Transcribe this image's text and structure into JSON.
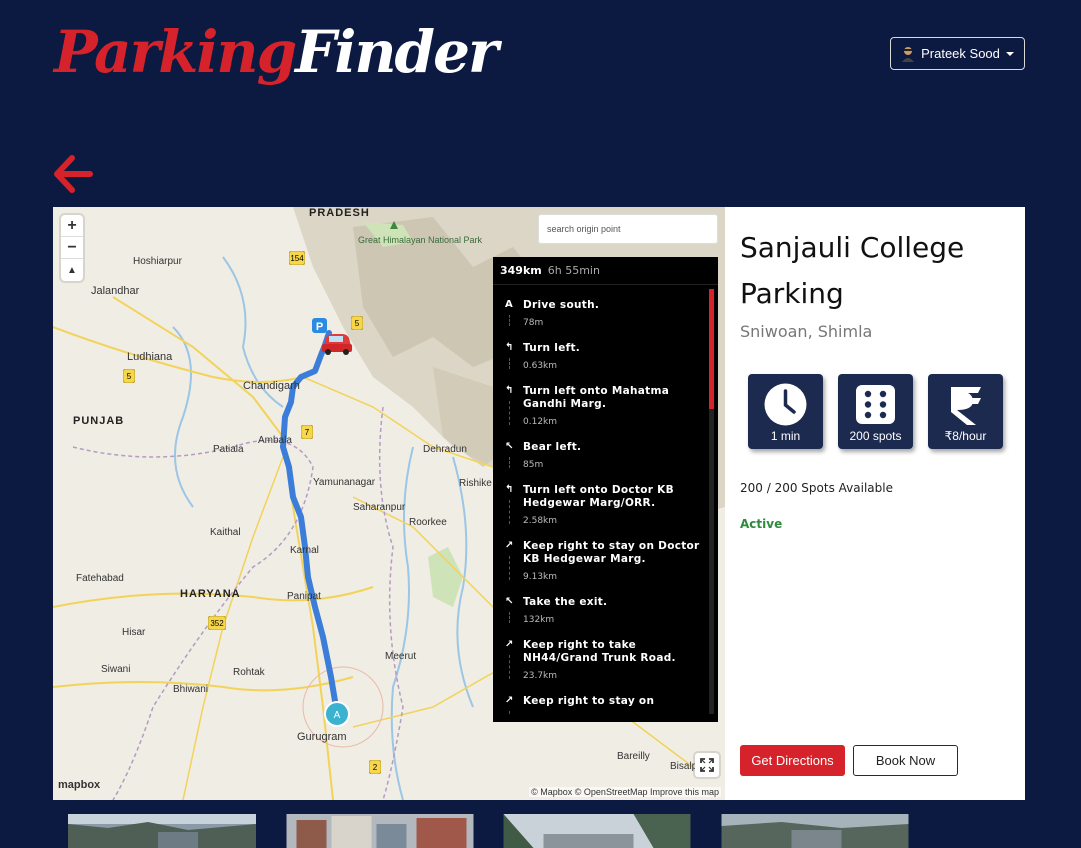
{
  "header": {
    "logo_part1": "Parking",
    "logo_part2": "Finder",
    "user_name": "Prateek Sood"
  },
  "map": {
    "origin_placeholder": "search origin point",
    "zoom_in": "+",
    "zoom_out": "−",
    "compass": "▲",
    "labels": {
      "pradesh": "PRADESH",
      "great_himalayan": "Great Himalayan National Park",
      "hoshiarpur": "Hoshiarpur",
      "jalandhar": "Jalandhar",
      "ludhiana": "Ludhiana",
      "chandigarh": "Chandigarh",
      "punjab": "PUNJAB",
      "ambala": "Ambala",
      "patiala": "Patiala",
      "yamunanagar": "Yamunanagar",
      "dehradun": "Dehradun",
      "rishikesh": "Rishike",
      "saharanpur": "Saharanpur",
      "roorkee": "Roorkee",
      "kaithal": "Kaithal",
      "karnal": "Karnal",
      "fatehabad": "Fatehabad",
      "haryana": "HARYANA",
      "panipat": "Panipat",
      "hisar": "Hisar",
      "siwani": "Siwani",
      "rohtak": "Rohtak",
      "bhiwani": "Bhiwani",
      "meerut": "Meerut",
      "gurugram": "Gurugram",
      "bareilly": "Bareilly",
      "bisalpur": "Bisalp"
    },
    "road_badges": [
      "154",
      "5",
      "5",
      "7",
      "352",
      "2"
    ],
    "start_marker": "A",
    "parking_marker": "P",
    "mapbox_logo": "mapbox",
    "attribution": "© Mapbox © OpenStreetMap Improve this map"
  },
  "directions": {
    "distance": "349km",
    "duration": "6h 55min",
    "steps": [
      {
        "icon": "A",
        "text": "Drive south.",
        "dist": "78m"
      },
      {
        "icon": "↰",
        "text": "Turn left.",
        "dist": "0.63km"
      },
      {
        "icon": "↰",
        "text": "Turn left onto Mahatma Gandhi Marg.",
        "dist": "0.12km"
      },
      {
        "icon": "↖",
        "text": "Bear left.",
        "dist": "85m"
      },
      {
        "icon": "↰",
        "text": "Turn left onto Doctor KB Hedgewar Marg/ORR.",
        "dist": "2.58km"
      },
      {
        "icon": "↗",
        "text": "Keep right to stay on Doctor KB Hedgewar Marg.",
        "dist": "9.13km"
      },
      {
        "icon": "↖",
        "text": "Take the exit.",
        "dist": "132km"
      },
      {
        "icon": "↗",
        "text": "Keep right to take NH44/Grand Trunk Road.",
        "dist": "23.7km"
      },
      {
        "icon": "↗",
        "text": "Keep right to stay on",
        "dist": ""
      }
    ]
  },
  "parking": {
    "name": "Sanjauli College Parking",
    "location": "Sniwoan, Shimla",
    "stat_time": "1 min",
    "stat_spots": "200 spots",
    "stat_price": "₹8/hour",
    "availability": "200 / 200 Spots Available",
    "status": "Active",
    "get_directions": "Get Directions",
    "book_now": "Book Now"
  },
  "colors": {
    "background": "#0c1940",
    "accent": "#d6232b",
    "stat_box": "#1c2a4f",
    "status_active": "#2e8b3d",
    "route": "#3b7dd8"
  }
}
